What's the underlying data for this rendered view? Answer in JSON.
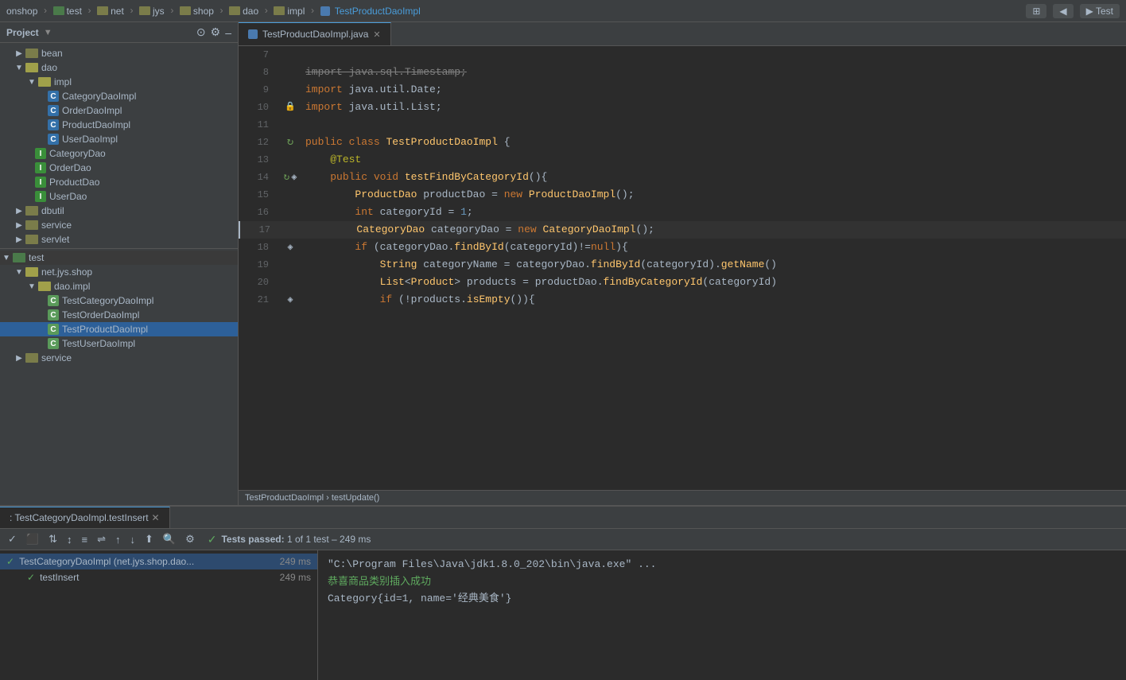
{
  "topbar": {
    "breadcrumbs": [
      "onshop",
      "test",
      "net",
      "jys",
      "shop",
      "dao",
      "impl",
      "TestProductDaoImpl"
    ],
    "active_file": "TestProductDaoImpl"
  },
  "tab": {
    "label": "TestProductDaoImpl.java",
    "icon": "java-icon"
  },
  "sidebar": {
    "title": "Project",
    "tree": [
      {
        "id": "bean",
        "label": "bean",
        "type": "folder",
        "indent": 1,
        "open": false
      },
      {
        "id": "dao",
        "label": "dao",
        "type": "folder",
        "indent": 1,
        "open": true
      },
      {
        "id": "impl",
        "label": "impl",
        "type": "folder",
        "indent": 2,
        "open": true
      },
      {
        "id": "CategoryDaoImpl",
        "label": "CategoryDaoImpl",
        "type": "class-c",
        "indent": 3
      },
      {
        "id": "OrderDaoImpl",
        "label": "OrderDaoImpl",
        "type": "class-c",
        "indent": 3
      },
      {
        "id": "ProductDaoImpl",
        "label": "ProductDaoImpl",
        "type": "class-c",
        "indent": 3
      },
      {
        "id": "UserDaoImpl",
        "label": "UserDaoImpl",
        "type": "class-c",
        "indent": 3
      },
      {
        "id": "CategoryDao",
        "label": "CategoryDao",
        "type": "class-i",
        "indent": 2
      },
      {
        "id": "OrderDao",
        "label": "OrderDao",
        "type": "class-i",
        "indent": 2
      },
      {
        "id": "ProductDao",
        "label": "ProductDao",
        "type": "class-i",
        "indent": 2
      },
      {
        "id": "UserDao",
        "label": "UserDao",
        "type": "class-i",
        "indent": 2
      },
      {
        "id": "dbutil",
        "label": "dbutil",
        "type": "folder",
        "indent": 1,
        "open": false
      },
      {
        "id": "service",
        "label": "service",
        "type": "folder",
        "indent": 1,
        "open": false
      },
      {
        "id": "servlet",
        "label": "servlet",
        "type": "folder",
        "indent": 1,
        "open": false
      },
      {
        "id": "test-root",
        "label": "test",
        "type": "folder-root",
        "indent": 0,
        "open": true
      },
      {
        "id": "net.jys.shop",
        "label": "net.jys.shop",
        "type": "folder",
        "indent": 1,
        "open": true
      },
      {
        "id": "dao.impl",
        "label": "dao.impl",
        "type": "folder",
        "indent": 2,
        "open": true
      },
      {
        "id": "TestCategoryDaoImpl",
        "label": "TestCategoryDaoImpl",
        "type": "class-c",
        "indent": 3
      },
      {
        "id": "TestOrderDaoImpl",
        "label": "TestOrderDaoImpl",
        "type": "class-c",
        "indent": 3
      },
      {
        "id": "TestProductDaoImpl",
        "label": "TestProductDaoImpl",
        "type": "class-c",
        "indent": 3,
        "selected": true
      },
      {
        "id": "TestUserDaoImpl",
        "label": "TestUserDaoImpl",
        "type": "class-c",
        "indent": 3
      },
      {
        "id": "service2",
        "label": "service",
        "type": "folder",
        "indent": 1,
        "open": false
      }
    ]
  },
  "code": {
    "lines": [
      {
        "num": 7,
        "content": "",
        "gutter": ""
      },
      {
        "num": 8,
        "content": "import_strike java.sql.Timestamp;",
        "gutter": ""
      },
      {
        "num": 9,
        "content": "import java.util.Date;",
        "gutter": ""
      },
      {
        "num": 10,
        "content": "import java.util.List;",
        "gutter": "lock"
      },
      {
        "num": 11,
        "content": "",
        "gutter": ""
      },
      {
        "num": 12,
        "content": "public class TestProductDaoImpl {",
        "gutter": "arrow-run"
      },
      {
        "num": 13,
        "content": "    @Test",
        "gutter": ""
      },
      {
        "num": 14,
        "content": "    public void testFindByCategoryId(){",
        "gutter": "arrow-run bookmark"
      },
      {
        "num": 15,
        "content": "        ProductDao productDao = new ProductDaoImpl();",
        "gutter": ""
      },
      {
        "num": 16,
        "content": "        int categoryId = 1;",
        "gutter": ""
      },
      {
        "num": 17,
        "content": "        CategoryDao categoryDao = new CategoryDaoImpl();",
        "gutter": "cursor"
      },
      {
        "num": 18,
        "content": "        if (categoryDao.findById(categoryId)!=null){",
        "gutter": "bookmark"
      },
      {
        "num": 19,
        "content": "            String categoryName = categoryDao.findById(categoryId).getName()",
        "gutter": ""
      },
      {
        "num": 20,
        "content": "            List<Product> products = productDao.findByCategoryId(categoryId)",
        "gutter": ""
      },
      {
        "num": 21,
        "content": "            if (!products.isEmpty()){",
        "gutter": "bookmark"
      }
    ],
    "breadcrumb": "TestProductDaoImpl  ›  testUpdate()"
  },
  "bottom_panel": {
    "tab_label": ": TestCategoryDaoImpl.testInsert ×",
    "toolbar_buttons": [
      "check",
      "stop",
      "sort-asc",
      "sort-desc",
      "align-left",
      "align-right",
      "up",
      "down",
      "export",
      "search",
      "settings"
    ],
    "status": "Tests passed: 1 of 1 test – 249 ms",
    "test_tree": [
      {
        "label": "TestCategoryDaoImpl (net.jys.shop.dao...",
        "time": "249 ms",
        "selected": true
      },
      {
        "label": "testInsert",
        "time": "249 ms",
        "indent": 1
      }
    ],
    "console_lines": [
      "\"C:\\Program Files\\Java\\jdk1.8.0_202\\bin\\java.exe\" ...",
      "恭喜商品类别插入成功",
      "Category{id=1,  name='经典美食'}"
    ]
  }
}
